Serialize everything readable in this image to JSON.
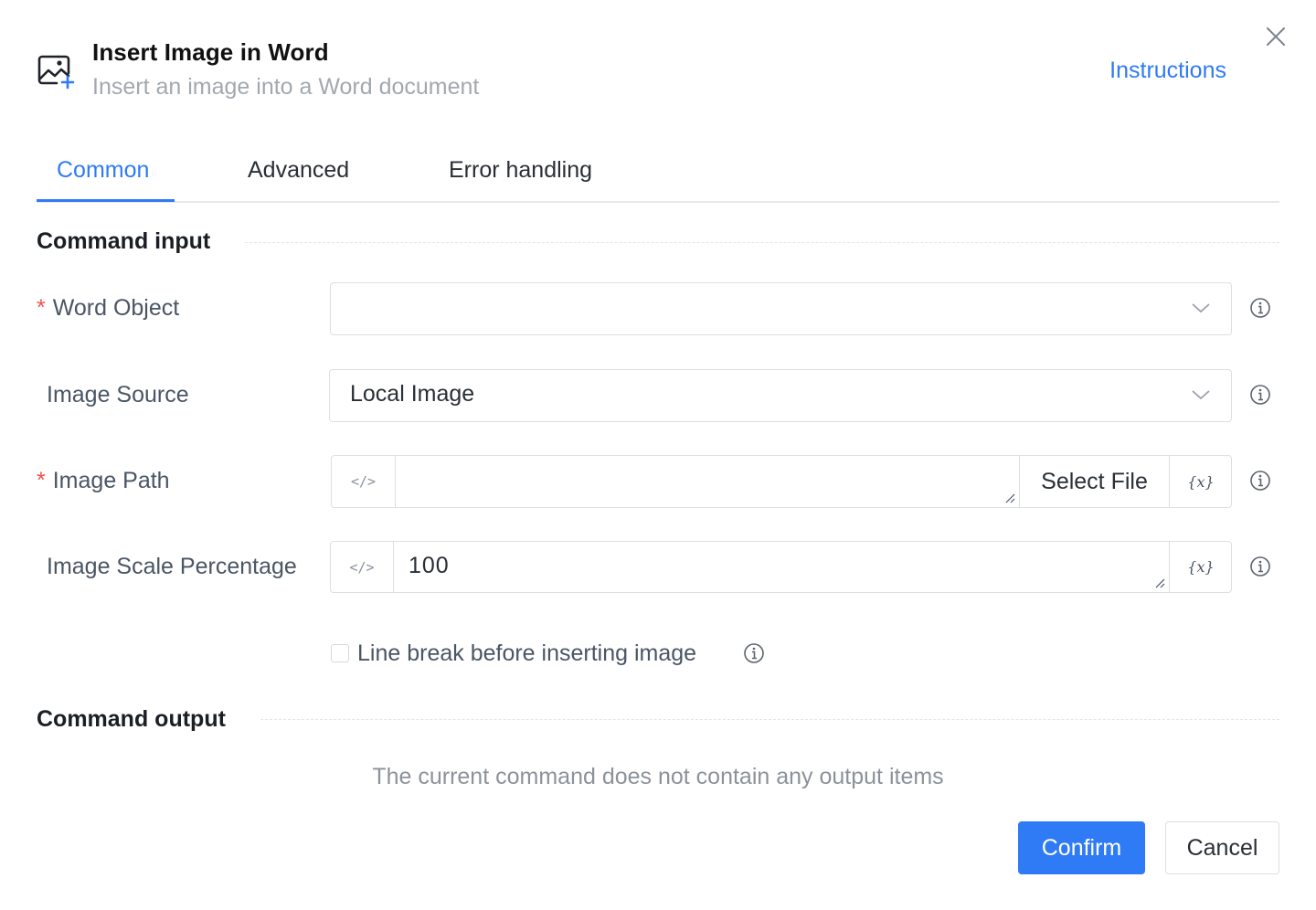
{
  "header": {
    "icon": "insert-image-icon",
    "title": "Insert Image in Word",
    "subtitle": "Insert an image into a Word document",
    "instructions_label": "Instructions",
    "close_icon": "close-icon"
  },
  "tabs": [
    {
      "label": "Common",
      "active": true
    },
    {
      "label": "Advanced",
      "active": false
    },
    {
      "label": "Error handling",
      "active": false
    }
  ],
  "sections": {
    "input_title": "Command input",
    "output_title": "Command output"
  },
  "fields": {
    "word_object": {
      "required": true,
      "required_mark": "*",
      "label": "Word Object",
      "value": ""
    },
    "image_source": {
      "required": false,
      "label": "Image Source",
      "value": "Local Image"
    },
    "image_path": {
      "required": true,
      "required_mark": "*",
      "label": "Image Path",
      "value": "",
      "select_file_label": "Select File",
      "var_label": "{x}",
      "code_label": "</>"
    },
    "image_scale": {
      "required": false,
      "label": "Image Scale Percentage",
      "value": "100",
      "var_label": "{x}",
      "code_label": "</>"
    }
  },
  "checkbox": {
    "label": "Line break before inserting image",
    "checked": false
  },
  "output": {
    "empty_text": "The current command does not contain any output items"
  },
  "footer": {
    "confirm_label": "Confirm",
    "cancel_label": "Cancel"
  },
  "colors": {
    "accent": "#2f7bf5",
    "required": "#f0514f",
    "muted": "#a3a8b0"
  }
}
